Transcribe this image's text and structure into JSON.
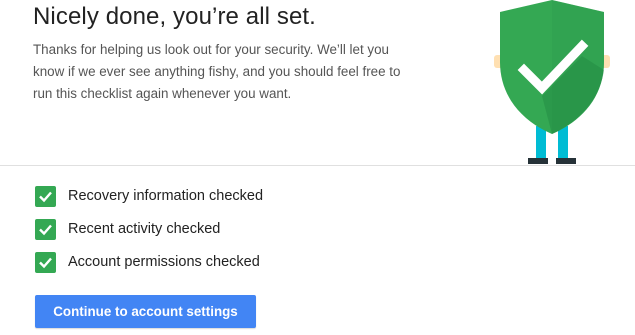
{
  "header": {
    "title": "Nicely done, you’re all set.",
    "description": "Thanks for helping us look out for your security. We’ll let you know if we ever see anything fishy, and you should feel free to run this checklist again whenever you want."
  },
  "checklist": {
    "items": [
      {
        "label": "Recovery information checked",
        "icon": "checkmark-icon"
      },
      {
        "label": "Recent activity checked",
        "icon": "checkmark-icon"
      },
      {
        "label": "Account permissions checked",
        "icon": "checkmark-icon"
      }
    ]
  },
  "actions": {
    "continue_label": "Continue to account settings"
  },
  "illustration": {
    "icon": "security-shield-character",
    "shield_color": "#34a853",
    "shield_shadow_color": "#2a8f47",
    "leg_color": "#00bcd4",
    "shoe_color": "#263238",
    "hand_color": "#ffe0b2"
  },
  "colors": {
    "accent": "#4285f4",
    "check": "#34a853"
  }
}
